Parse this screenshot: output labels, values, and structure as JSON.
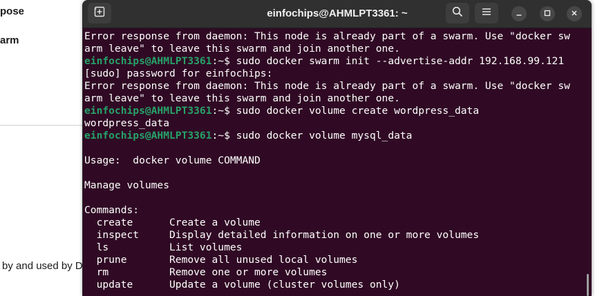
{
  "background": {
    "word1": "pose",
    "word2": "arm",
    "footer_text": "by and used by D"
  },
  "window": {
    "title": "einfochips@AHMLPT3361: ~",
    "new_tab_icon": "new-tab-icon",
    "search_icon": "search-icon",
    "menu_icon": "hamburger-menu-icon",
    "minimize_icon": "minimize-icon",
    "maximize_icon": "maximize-icon",
    "close_icon": "close-icon"
  },
  "terminal": {
    "colors": {
      "background": "#300a24",
      "prompt_user": "#26a269",
      "text": "#ffffff"
    },
    "lines": [
      {
        "text": "Error response from daemon: This node is already part of a swarm. Use \"docker sw"
      },
      {
        "text": "arm leave\" to leave this swarm and join another one."
      },
      {
        "user": "einfochips@AHMLPT3361",
        "path": ":~$ ",
        "cmd": "sudo docker swarm init --advertise-addr 192.168.99.121"
      },
      {
        "text": "[sudo] password for einfochips:"
      },
      {
        "text": "Error response from daemon: This node is already part of a swarm. Use \"docker sw"
      },
      {
        "text": "arm leave\" to leave this swarm and join another one."
      },
      {
        "user": "einfochips@AHMLPT3361",
        "path": ":~$ ",
        "cmd": "sudo docker volume create wordpress_data"
      },
      {
        "text": "wordpress_data"
      },
      {
        "user": "einfochips@AHMLPT3361",
        "path": ":~$ ",
        "cmd": "sudo docker volume mysql_data"
      },
      {
        "text": ""
      },
      {
        "text": "Usage:  docker volume COMMAND"
      },
      {
        "text": ""
      },
      {
        "text": "Manage volumes"
      },
      {
        "text": ""
      },
      {
        "text": "Commands:"
      },
      {
        "text": "  create      Create a volume"
      },
      {
        "text": "  inspect     Display detailed information on one or more volumes"
      },
      {
        "text": "  ls          List volumes"
      },
      {
        "text": "  prune       Remove all unused local volumes"
      },
      {
        "text": "  rm          Remove one or more volumes"
      },
      {
        "text": "  update      Update a volume (cluster volumes only)"
      }
    ]
  }
}
